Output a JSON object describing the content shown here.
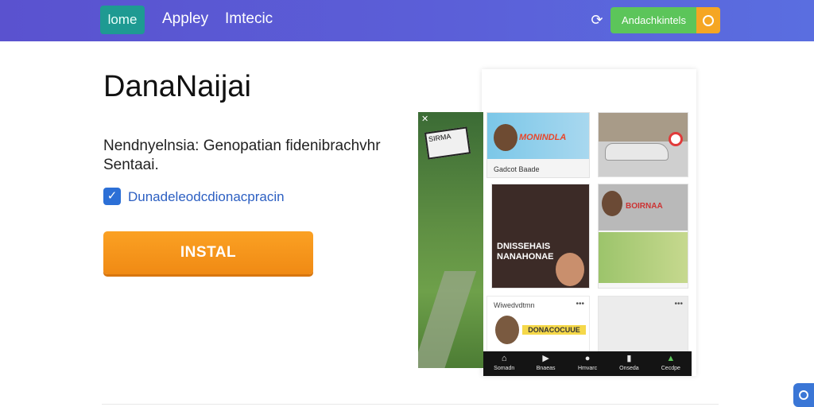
{
  "nav": {
    "home": "lome",
    "apps": "Appley",
    "integrations": "Imtecic",
    "cta_label": "Andachkintels",
    "refresh_icon": "refresh-icon",
    "cta_icon": "search-icon"
  },
  "hero": {
    "title": "DanaNaijai",
    "description": "Nendnyelnsia: Genopatian fidenibrachvhr Sentaai.",
    "checkbox_label": "Dunadeleodcdionacpracin",
    "checkbox_checked": true,
    "install_label": "INSTAL"
  },
  "preview": {
    "sign_text": "SIRMA",
    "tile1": {
      "banner": "MONINDLA",
      "caption": "Gadcot Baade"
    },
    "tile3": {
      "overlay": "DNISSEHAIS\nNANAHONAE"
    },
    "tile4": {
      "caption": "BOIRNAA"
    },
    "tile5": {
      "caption": "Wiwedvdtmn",
      "highlight": "DONACOCUUE"
    },
    "bottom_nav": [
      {
        "icon": "home-icon",
        "glyph": "⌂",
        "label": "Somadn"
      },
      {
        "icon": "play-icon",
        "glyph": "▶",
        "label": "Bnaeas"
      },
      {
        "icon": "chat-icon",
        "glyph": "●",
        "label": "Hmvarc"
      },
      {
        "icon": "library-icon",
        "glyph": "▮",
        "label": "Onseda"
      },
      {
        "icon": "profile-icon",
        "glyph": "▲",
        "label": "Cecdpe"
      }
    ]
  },
  "colors": {
    "topbar": "#5a52cf",
    "home_tab": "#1e9a92",
    "cta": "#5cc55a",
    "cta_icon_bg": "#f5a623",
    "install": "#f08a14",
    "checkbox": "#2c6fd6"
  }
}
